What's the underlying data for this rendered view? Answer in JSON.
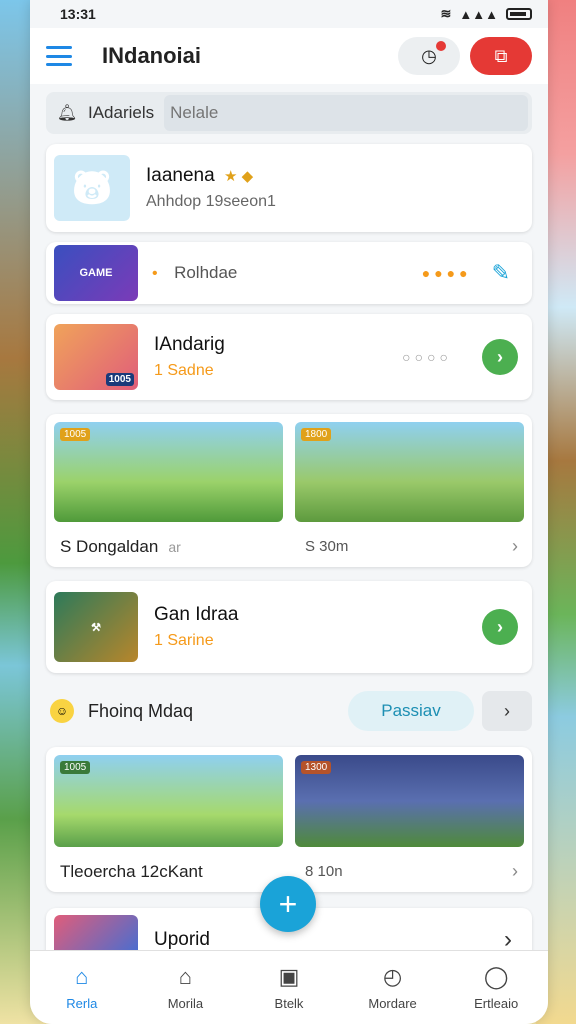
{
  "status": {
    "time": "13:31",
    "signal": "▲▲▲",
    "wifi": "≋"
  },
  "header": {
    "title": "INdanoiai"
  },
  "search": {
    "label": "IAdariels",
    "placeholder": "Nelale"
  },
  "profile": {
    "title": "Iaanenа",
    "subtitle": "Ahhdop 19seeon1",
    "badge_icons": "★ ◆"
  },
  "row1": {
    "label": "Rolhdae",
    "dots": "●●●●"
  },
  "row2": {
    "title": "IAndarig",
    "subtitle": "1 Sadne",
    "tag": "1005",
    "dots": "○○○○"
  },
  "gallery1": {
    "left_label": "S Dongaldan",
    "left_extra": "ar",
    "right_label": "S 30m",
    "tag_left": "1005",
    "tag_right": "1800"
  },
  "row3": {
    "title": "Gan Idraa",
    "subtitle": "1 Sarine"
  },
  "section": {
    "title": "Fhoinq Mdaq",
    "button": "Passiav"
  },
  "gallery2": {
    "left_label": "Tleoercha 12cKant",
    "right_label": "8 10n",
    "tag_left": "1005",
    "tag_right": "1300"
  },
  "row4": {
    "title": "Uporid"
  },
  "nav": [
    {
      "label": "Rerla",
      "icon": "⌂"
    },
    {
      "label": "Morila",
      "icon": "⌂"
    },
    {
      "label": "Btelk",
      "icon": "▣"
    },
    {
      "label": "Mordare",
      "icon": "◴"
    },
    {
      "label": "Ertleaio",
      "icon": "◯"
    }
  ],
  "colors": {
    "accent": "#1e88e5",
    "fab": "#1aa3d8",
    "go": "#4caf50",
    "alert": "#e53935",
    "highlight": "#f59a1a"
  }
}
